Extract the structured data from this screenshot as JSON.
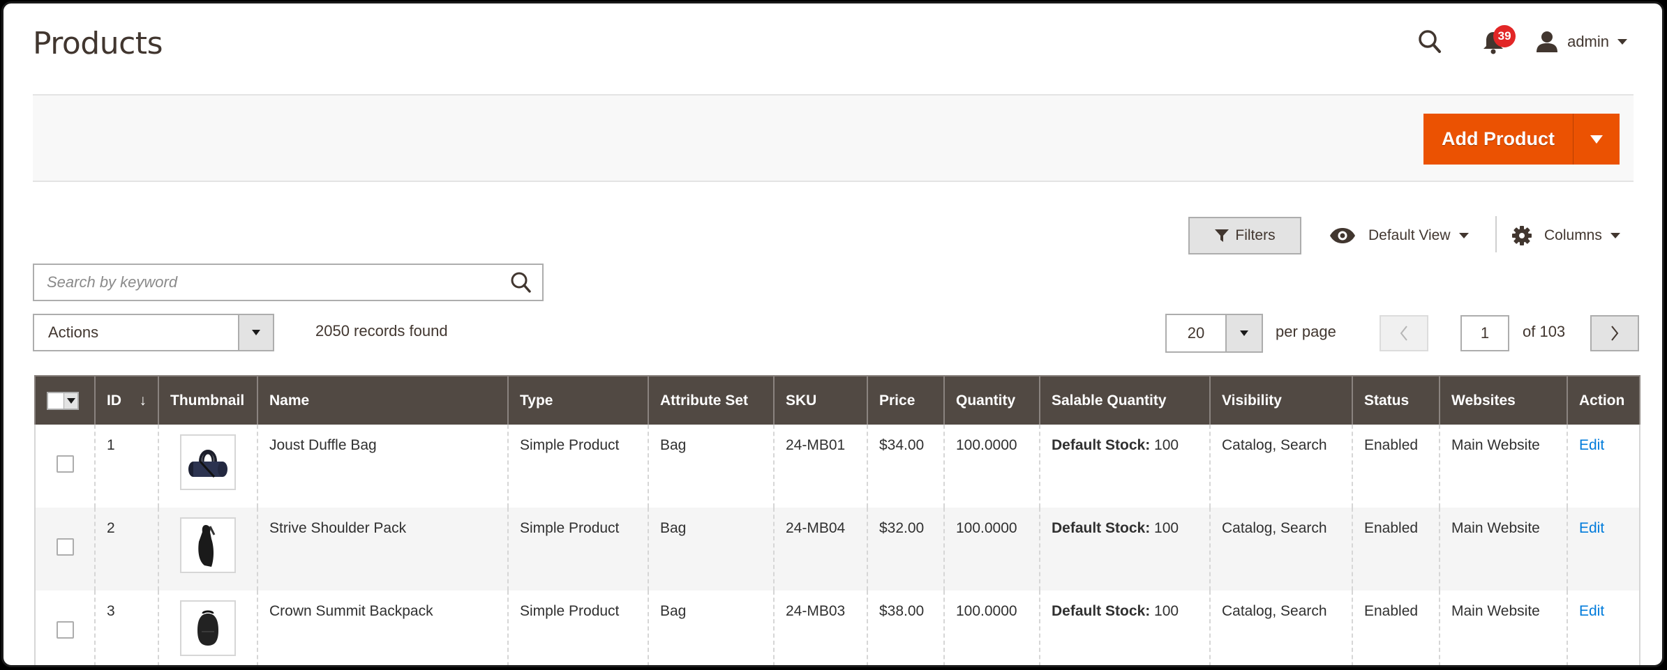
{
  "header": {
    "title": "Products",
    "notifications_count": "39",
    "user_name": "admin"
  },
  "action_bar": {
    "add_product_label": "Add Product"
  },
  "toolbar": {
    "filters_label": "Filters",
    "view_label": "Default View",
    "columns_label": "Columns",
    "search_placeholder": "Search by keyword",
    "search_value": "",
    "actions_label": "Actions",
    "records_found": "2050 records found",
    "per_page_value": "20",
    "per_page_label": "per page",
    "current_page": "1",
    "of_pages": "of 103"
  },
  "colors": {
    "accent": "#eb5202",
    "header_bg": "#514943",
    "badge": "#e22626",
    "link": "#007bdb"
  },
  "table": {
    "columns": [
      "ID",
      "Thumbnail",
      "Name",
      "Type",
      "Attribute Set",
      "SKU",
      "Price",
      "Quantity",
      "Salable Quantity",
      "Visibility",
      "Status",
      "Websites",
      "Action"
    ],
    "sort_indicator": "↓",
    "rows": [
      {
        "id": "1",
        "thumbnail": "duffle-bag-image",
        "name": "Joust Duffle Bag",
        "type": "Simple Product",
        "attribute_set": "Bag",
        "sku": "24-MB01",
        "price": "$34.00",
        "quantity": "100.0000",
        "salable_label": "Default Stock:",
        "salable_value": " 100",
        "visibility": "Catalog, Search",
        "status": "Enabled",
        "websites": "Main Website",
        "action": "Edit"
      },
      {
        "id": "2",
        "thumbnail": "shoulder-pack-image",
        "name": "Strive Shoulder Pack",
        "type": "Simple Product",
        "attribute_set": "Bag",
        "sku": "24-MB04",
        "price": "$32.00",
        "quantity": "100.0000",
        "salable_label": "Default Stock:",
        "salable_value": " 100",
        "visibility": "Catalog, Search",
        "status": "Enabled",
        "websites": "Main Website",
        "action": "Edit"
      },
      {
        "id": "3",
        "thumbnail": "backpack-image",
        "name": "Crown Summit Backpack",
        "type": "Simple Product",
        "attribute_set": "Bag",
        "sku": "24-MB03",
        "price": "$38.00",
        "quantity": "100.0000",
        "salable_label": "Default Stock:",
        "salable_value": " 100",
        "visibility": "Catalog, Search",
        "status": "Enabled",
        "websites": "Main Website",
        "action": "Edit"
      }
    ]
  }
}
